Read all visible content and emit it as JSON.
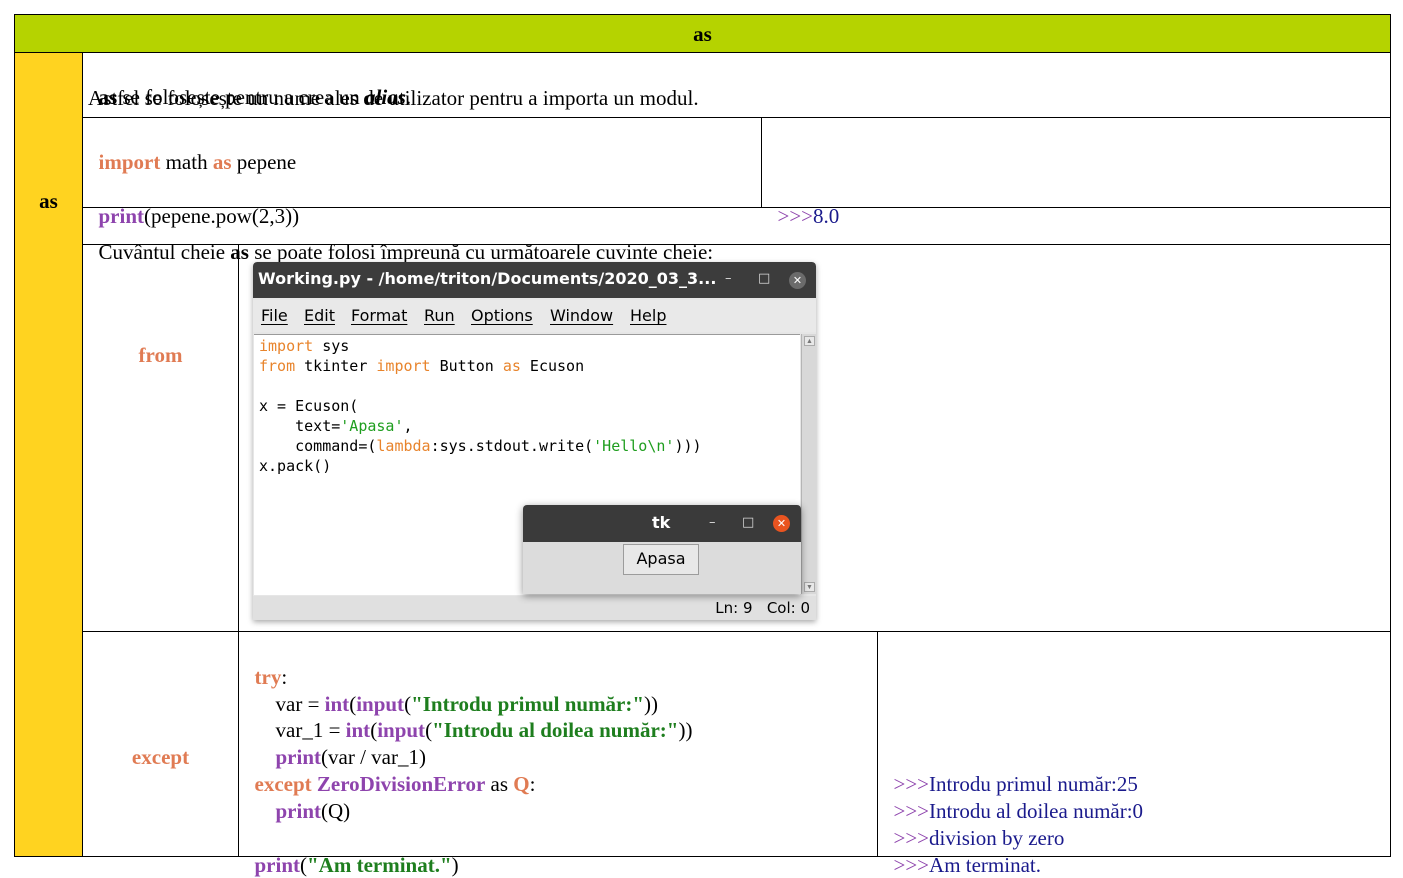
{
  "header": {
    "title": "as"
  },
  "side_label": "as",
  "intro": {
    "line1_kw": "as",
    "line1_text": " se folosește pentru a crea un ",
    "line1_alias": "alias",
    "line1_end": ".",
    "line2": "Astfel se folosește un nume ales de utilizator pentru a importa un modul."
  },
  "example1": {
    "kw_import": "import",
    "mid": " math ",
    "kw_as": "as",
    "alias": " pepene",
    "fn_print": "print",
    "call": "(pepene.pow(2,3))",
    "output_prompt": ">>>",
    "output_value": "8.0"
  },
  "related": {
    "pre": "Cuvântul cheie ",
    "kw": "as",
    "post": " se poate folosi împreună cu următoarele cuvinte cheie:"
  },
  "from_row": {
    "label": "from",
    "idle": {
      "title": "Working.py - /home/triton/Documents/2020_03_3...",
      "menu": [
        "File",
        "Edit",
        "Format",
        "Run",
        "Options",
        "Window",
        "Help"
      ],
      "code": {
        "l1_kw": "import",
        "l1_rest": " sys",
        "l2_kw1": "from",
        "l2_mid": " tkinter ",
        "l2_kw2": "import",
        "l2_mid2": " Button ",
        "l2_kw3": "as",
        "l2_rest": " Ecuson",
        "l4": "x = Ecuson(",
        "l5_pre": "    text=",
        "l5_str": "'Apasa'",
        "l5_post": ",",
        "l6_pre": "    command=(",
        "l6_kw": "lambda",
        "l6_mid": ":sys.stdout.write(",
        "l6_str": "'Hello\\n'",
        "l6_post": ")))",
        "l7": "x.pack()"
      },
      "status": "Ln: 9   Col: 0",
      "tk": {
        "title": "tk",
        "button": "Apasa"
      }
    }
  },
  "except_row": {
    "label": "except",
    "code": {
      "try_kw": "try",
      "try_colon": ":",
      "l2_pre": "    var = ",
      "l2_int": "int",
      "l2_p1": "(",
      "l2_input": "input",
      "l2_p2": "(",
      "l2_str": "\"Introdu primul număr:\"",
      "l2_end": "))",
      "l3_pre": "    var_1 = ",
      "l3_int": "int",
      "l3_p1": "(",
      "l3_input": "input",
      "l3_p2": "(",
      "l3_str": "\"Introdu al doilea număr:\"",
      "l3_end": "))",
      "l4_pre": "    ",
      "l4_print": "print",
      "l4_rest": "(var / var_1)",
      "l5_except": "except",
      "l5_sp": " ",
      "l5_err": "ZeroDivisionError",
      "l5_as": " as ",
      "l5_q": "Q",
      "l5_colon": ":",
      "l6_pre": "    ",
      "l6_print": "print",
      "l6_rest": "(Q)",
      "l8_print": "print",
      "l8_p1": "(",
      "l8_str": "\"Am terminat.\"",
      "l8_p2": ")"
    },
    "output": [
      {
        "prompt": ">>>",
        "text": "Introdu primul număr:25"
      },
      {
        "prompt": ">>>",
        "text": "Introdu al doilea număr:0"
      },
      {
        "prompt": ">>>",
        "text": "division by zero"
      },
      {
        "prompt": ">>>",
        "text": "Am terminat."
      }
    ]
  },
  "colors": {
    "header_bg": "#b5d300",
    "side_bg": "#ffd320",
    "keyword": "#e07b53",
    "function": "#8e44ad",
    "string": "#1e7e1e",
    "output": "#1a1a8c"
  }
}
